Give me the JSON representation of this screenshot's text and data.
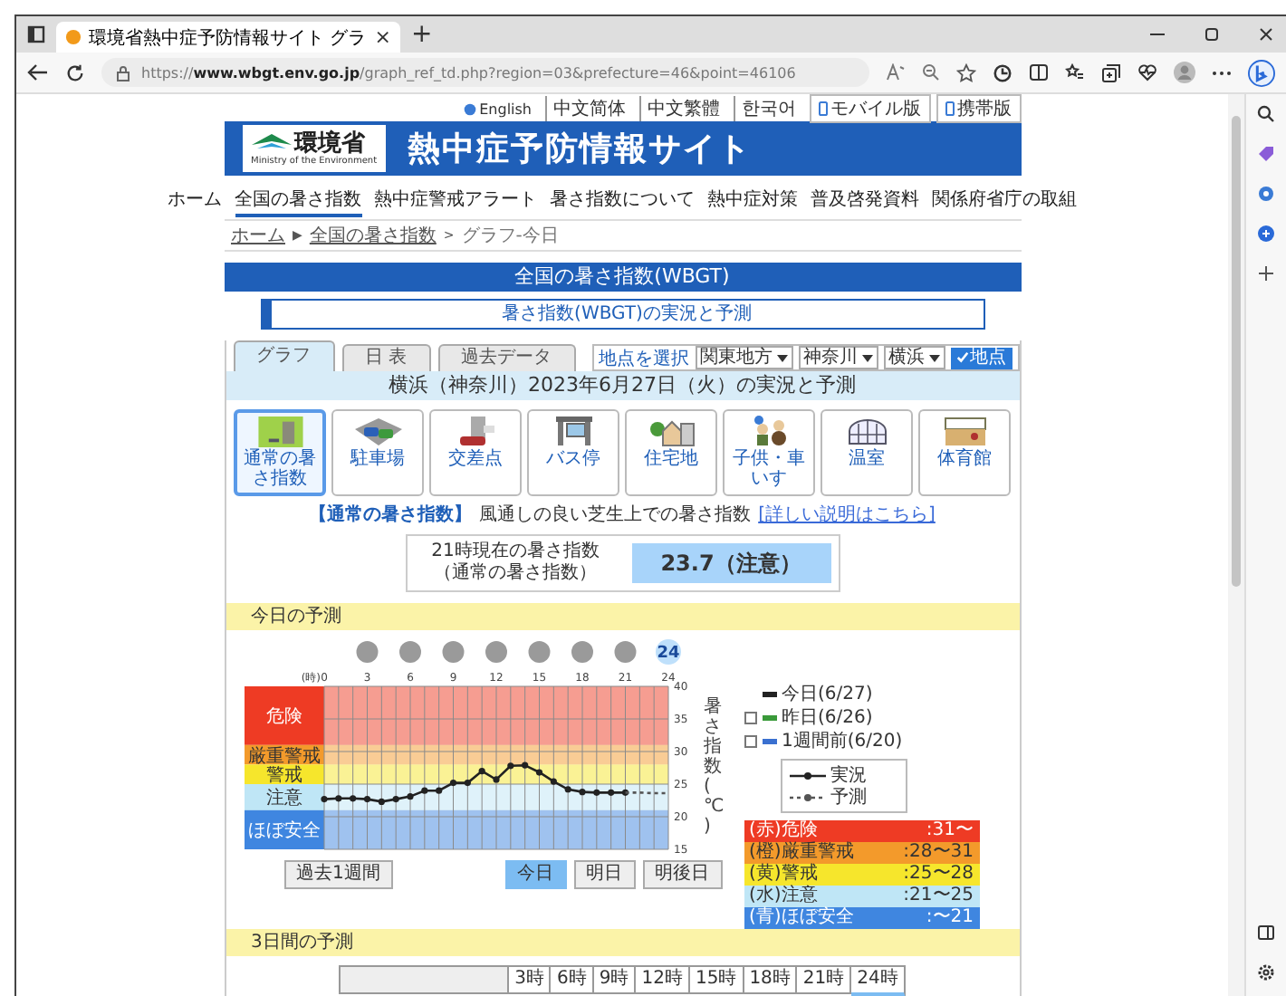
{
  "browser": {
    "tab_title": "環境省熱中症予防情報サイト グラ",
    "tab_close": "×",
    "new_tab": "+",
    "url": "https://**www.wbgt.env.go.jp**/graph_ref_td.php?region=03&prefecture=46&point=46106"
  },
  "languages": [
    {
      "label": "English",
      "kind": "globe"
    },
    {
      "label": "中文简体",
      "kind": "plain"
    },
    {
      "label": "中文繁體",
      "kind": "plain"
    },
    {
      "label": "한국어",
      "kind": "plain"
    },
    {
      "label": "モバイル版",
      "kind": "device"
    },
    {
      "label": "携帯版",
      "kind": "device"
    }
  ],
  "site": {
    "ministry": "環境省",
    "ministry_en": "Ministry of the Environment",
    "title": "熱中症予防情報サイト"
  },
  "nav": [
    {
      "label": "ホーム",
      "selected": false
    },
    {
      "label": "全国の暑さ指数",
      "selected": true
    },
    {
      "label": "熱中症警戒アラート",
      "selected": false
    },
    {
      "label": "暑さ指数について",
      "selected": false
    },
    {
      "label": "熱中症対策",
      "selected": false
    },
    {
      "label": "普及啓発資料",
      "selected": false
    },
    {
      "label": "関係府省庁の取組",
      "selected": false
    }
  ],
  "breadcrumb": [
    {
      "label": "ホーム",
      "kind": "link"
    },
    {
      "label": "▶",
      "kind": "sep"
    },
    {
      "label": "全国の暑さ指数",
      "kind": "link"
    },
    {
      "label": ">",
      "kind": "sep"
    },
    {
      "label": "グラフ-今日",
      "kind": "current"
    }
  ],
  "section_title": "全国の暑さ指数(WBGT)",
  "subtitle": "暑さ指数(WBGT)の実況と予測",
  "view_tabs": [
    {
      "label": "グラフ",
      "selected": true
    },
    {
      "label": "日 表",
      "selected": false
    },
    {
      "label": "過去データ",
      "selected": false
    }
  ],
  "location": {
    "label": "地点を選択",
    "selects": [
      "関東地方",
      "神奈川",
      "横浜"
    ],
    "button": "地点"
  },
  "heading": "横浜（神奈川）2023年6月27日（火）の実況と予測",
  "places": [
    {
      "label": "通常の暑さ指数",
      "kind": "lawn",
      "selected": true
    },
    {
      "label": "駐車場",
      "kind": "parking",
      "selected": false
    },
    {
      "label": "交差点",
      "kind": "crossing",
      "selected": false
    },
    {
      "label": "バス停",
      "kind": "bus",
      "selected": false
    },
    {
      "label": "住宅地",
      "kind": "houses",
      "selected": false
    },
    {
      "label": "子供・車いす",
      "kind": "children",
      "selected": false
    },
    {
      "label": "温室",
      "kind": "greenhouse",
      "selected": false
    },
    {
      "label": "体育館",
      "kind": "gym",
      "selected": false
    }
  ],
  "description": {
    "term": "【通常の暑さ指数】",
    "text": "風通しの良い芝生上での暑さ指数",
    "link": "[詳しい説明はこちら]"
  },
  "current": {
    "label": "21時現在の暑さ指数",
    "sublabel": "（通常の暑さ指数）",
    "value": "23.7（注意）"
  },
  "today": {
    "title": "今日の予測",
    "marks": [
      {
        "kind": "dot"
      },
      {
        "kind": "dot"
      },
      {
        "kind": "dot"
      },
      {
        "kind": "dot"
      },
      {
        "kind": "dot"
      },
      {
        "kind": "dot"
      },
      {
        "kind": "dot"
      },
      {
        "kind": "hour",
        "text": "24"
      }
    ],
    "chart_data": {
      "type": "line",
      "xlabel": "(時)",
      "ylabel": "暑さ指数(℃)",
      "x": [
        0,
        1,
        2,
        3,
        4,
        5,
        6,
        7,
        8,
        9,
        10,
        11,
        12,
        13,
        14,
        15,
        16,
        17,
        18,
        19,
        20,
        21,
        22,
        23,
        24
      ],
      "xlim": [
        0,
        24
      ],
      "ylim": [
        15,
        40
      ],
      "grid": true,
      "xticks": [
        0,
        3,
        6,
        9,
        12,
        15,
        18,
        21,
        24
      ],
      "yticks": [
        15,
        20,
        25,
        30,
        35,
        40
      ],
      "series": [
        {
          "name": "実況",
          "color": "#222222",
          "line_style": "solid",
          "marker": "circle",
          "values": [
            22.7,
            22.8,
            22.8,
            22.7,
            22.3,
            22.7,
            23.1,
            24.0,
            24.0,
            25.2,
            25.2,
            27.0,
            25.7,
            27.8,
            27.9,
            26.8,
            25.4,
            24.2,
            23.8,
            23.7,
            23.7,
            23.7,
            null,
            null,
            null
          ]
        },
        {
          "name": "予測",
          "color": "#555555",
          "line_style": "dashed",
          "values": [
            null,
            null,
            null,
            null,
            null,
            null,
            null,
            null,
            null,
            null,
            null,
            null,
            null,
            null,
            null,
            null,
            null,
            null,
            null,
            null,
            null,
            23.7,
            23.7,
            23.6,
            23.6
          ]
        }
      ],
      "bands": [
        {
          "axis": "y",
          "from": 31,
          "to": 40,
          "label": "危険",
          "color": "#ee3b24"
        },
        {
          "axis": "y",
          "from": 28,
          "to": 31,
          "label": "厳重警戒",
          "color": "#f39a2b"
        },
        {
          "axis": "y",
          "from": 25,
          "to": 28,
          "label": "警戒",
          "color": "#f6e62c"
        },
        {
          "axis": "y",
          "from": 21,
          "to": 25,
          "label": "注意",
          "color": "#bfe6f6"
        },
        {
          "axis": "y",
          "from": 15,
          "to": 21,
          "label": "ほぼ安全",
          "color": "#3f86e0"
        }
      ]
    },
    "day_legend": {
      "today": {
        "label": "今日(6/27)",
        "color": "#222222"
      },
      "compare": [
        {
          "label": "昨日(6/26)",
          "color": "#3a9a3a",
          "checked": false
        },
        {
          "label": "1週間前(6/20)",
          "color": "#3a70d0",
          "checked": false
        }
      ]
    },
    "level_legend": [
      {
        "label": "(赤)危険",
        "range": ":31〜",
        "color": "#ee3b24"
      },
      {
        "label": "(橙)厳重警戒",
        "range": ":28〜31",
        "color": "#f39a2b"
      },
      {
        "label": "(黄)警戒",
        "range": ":25〜28",
        "color": "#f6e62c"
      },
      {
        "label": "(水)注意",
        "range": ":21〜25",
        "color": "#bfe6f6"
      },
      {
        "label": "(青)ほぼ安全",
        "range": ":〜21",
        "color": "#3f86e0"
      }
    ],
    "past_button": {
      "label": "過去1週間",
      "selected": false
    },
    "day_buttons": [
      {
        "label": "今日",
        "selected": true
      },
      {
        "label": "明日",
        "selected": false
      },
      {
        "label": "明後日",
        "selected": false
      }
    ]
  },
  "three_day": {
    "title": "3日間の予測",
    "columns": [
      {
        "label": "3時",
        "selected": false
      },
      {
        "label": "6時",
        "selected": false
      },
      {
        "label": "9時",
        "selected": false
      },
      {
        "label": "12時",
        "selected": false
      },
      {
        "label": "15時",
        "selected": false
      },
      {
        "label": "18時",
        "selected": false
      },
      {
        "label": "21時",
        "selected": false
      },
      {
        "label": "24時",
        "selected": true
      }
    ]
  }
}
